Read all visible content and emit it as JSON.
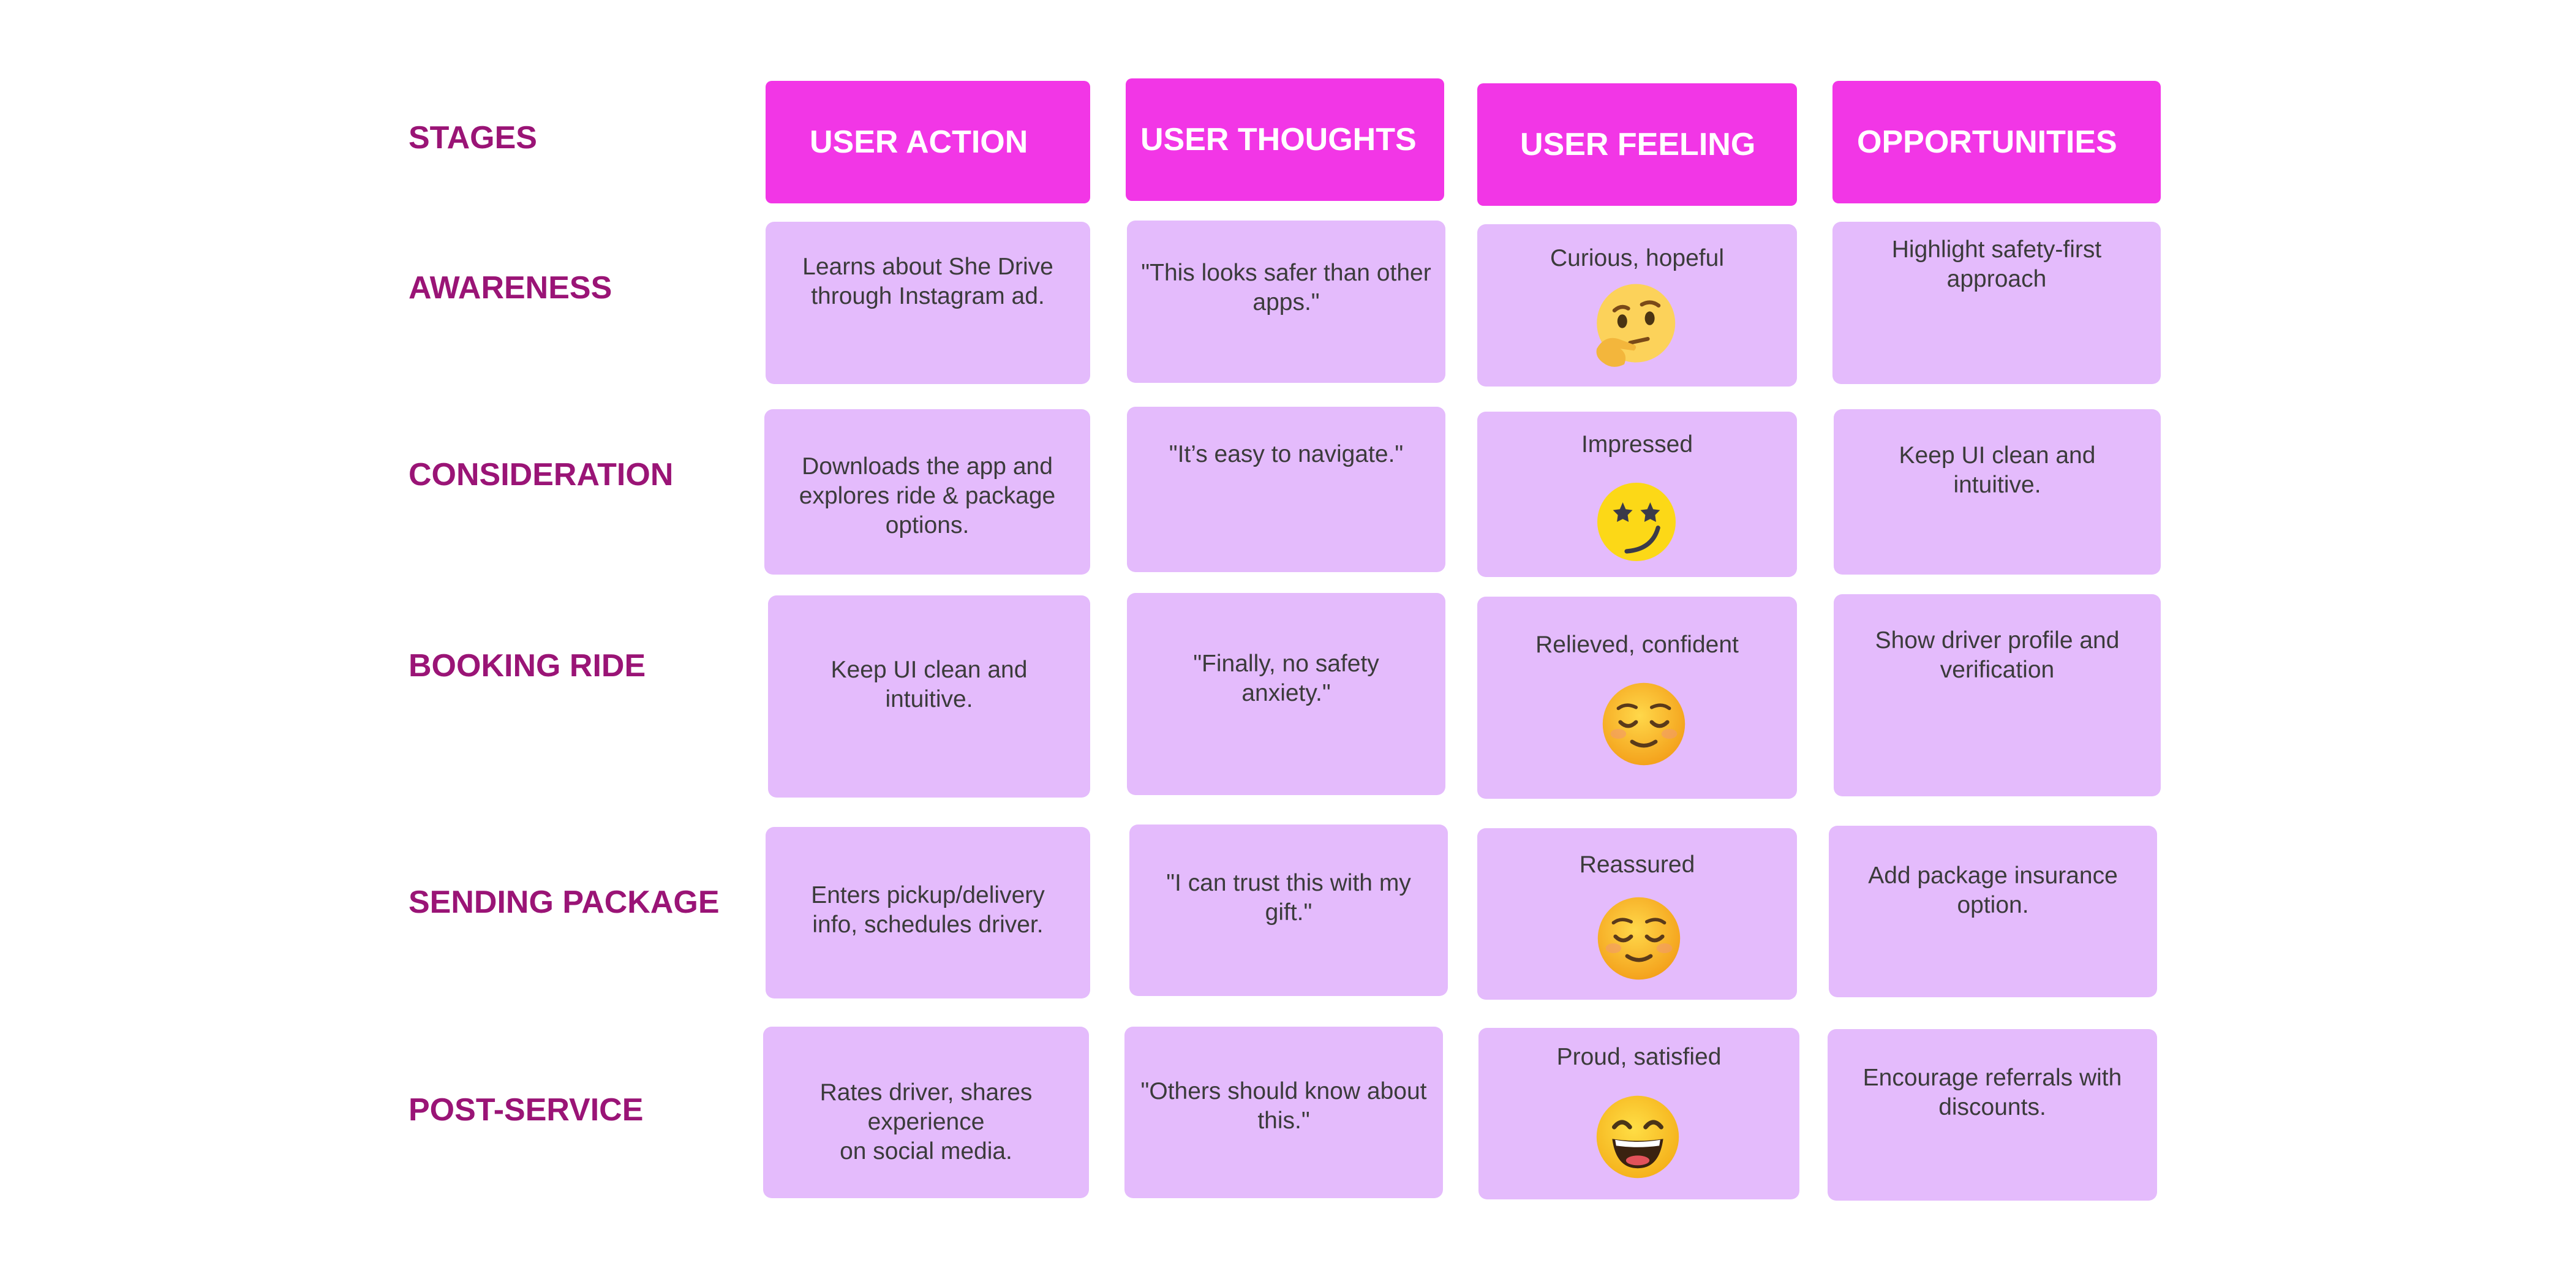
{
  "stages_label": "STAGES",
  "headers": [
    "USER ACTION",
    "USER THOUGHTS",
    "USER FEELING",
    "OPPORTUNITIES"
  ],
  "stages": [
    {
      "name": "AWARENESS",
      "action": "Learns about She Drive\nthrough Instagram ad.",
      "thought": "\"This looks safer than other\napps.\"",
      "feeling": "Curious, hopeful",
      "emoji": "thinking-face-icon",
      "opportunity": "Highlight safety-first\napproach"
    },
    {
      "name": "CONSIDERATION",
      "action": "Downloads the app and\nexplores ride & package\noptions.",
      "thought": "\"It’s easy to navigate.\"",
      "feeling": "Impressed",
      "emoji": "star-eyes-smirk-face-icon",
      "opportunity": "Keep UI clean and\nintuitive."
    },
    {
      "name": "BOOKING RIDE",
      "action": "Keep UI clean and\nintuitive.",
      "thought": "\"Finally, no safety\nanxiety.\"",
      "feeling": "Relieved, confident",
      "emoji": "relieved-face-icon",
      "opportunity": "Show driver profile and\nverification"
    },
    {
      "name": "SENDING PACKAGE",
      "action": "Enters pickup/delivery\ninfo, schedules driver.",
      "thought": "\"I can trust this with my\ngift.\"",
      "feeling": "Reassured",
      "emoji": "relieved-face-icon",
      "opportunity": "Add package insurance\noption."
    },
    {
      "name": "POST-SERVICE",
      "action": "Rates driver, shares experience\non social media.",
      "thought": "\"Others should know about\nthis.\"",
      "feeling": "Proud, satisfied",
      "emoji": "grinning-smiling-eyes-face-icon",
      "opportunity": "Encourage referrals with\ndiscounts."
    }
  ],
  "colors": {
    "header_bg": "#f236e6",
    "card_bg": "#e4bbfc",
    "stage_text": "#9a1476",
    "emoji_yellow": "#fcc21b"
  }
}
